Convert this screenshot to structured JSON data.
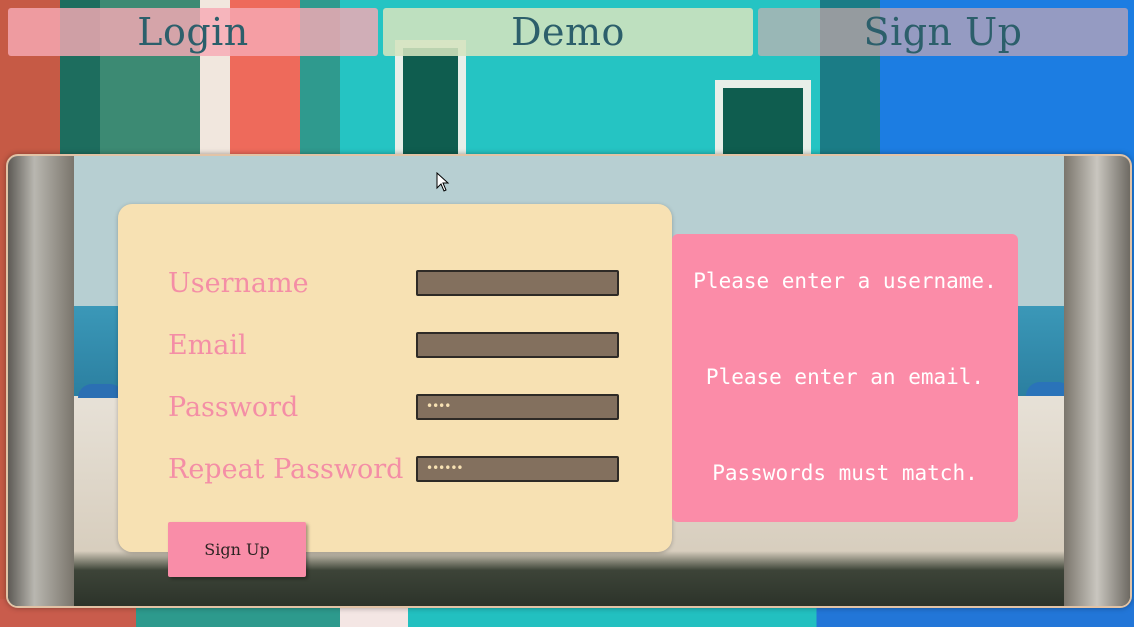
{
  "nav": {
    "login_label": "Login",
    "demo_label": "Demo",
    "signup_label": "Sign Up"
  },
  "form": {
    "fields": [
      {
        "label": "Username",
        "value": ""
      },
      {
        "label": "Email",
        "value": ""
      },
      {
        "label": "Password",
        "value": "••••"
      },
      {
        "label": "Repeat Password",
        "value": "••••••"
      }
    ],
    "submit_label": "Sign Up"
  },
  "errors": {
    "username": "Please enter a username.",
    "email": "Please enter an email.",
    "password": "Passwords must match."
  },
  "colors": {
    "label_pink": "#f48ea6",
    "card_cream": "#f7e1b3",
    "error_pink": "#fb8ca8",
    "input_brown": "#83705e",
    "nav_text": "#2c5f6b"
  },
  "icons": {
    "cursor": "mouse-pointer-icon"
  }
}
